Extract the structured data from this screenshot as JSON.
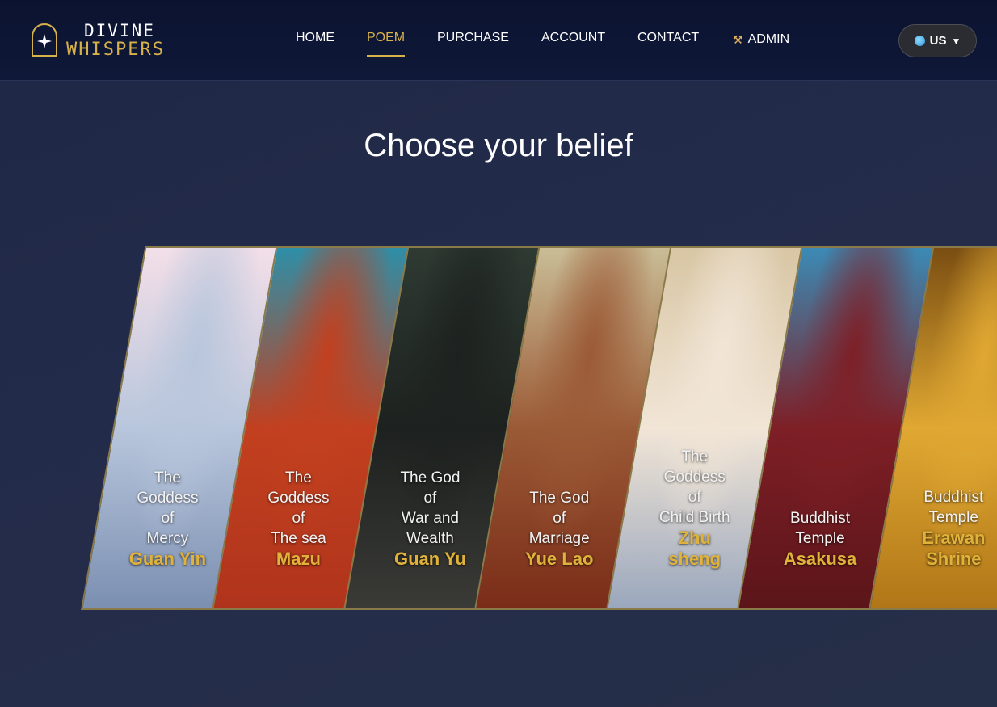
{
  "header": {
    "logo": {
      "line1": "DIVINE",
      "line2": "WHISPERS"
    },
    "nav": [
      {
        "label": "HOME",
        "active": false
      },
      {
        "label": "POEM",
        "active": true
      },
      {
        "label": "PURCHASE",
        "active": false
      },
      {
        "label": "ACCOUNT",
        "active": false
      },
      {
        "label": "CONTACT",
        "active": false
      },
      {
        "label": "ADMIN",
        "active": false,
        "icon": "hammer-wrench-icon"
      }
    ],
    "language": {
      "label": "US",
      "icon": "globe-icon"
    }
  },
  "main": {
    "title": "Choose your belief",
    "beliefs": [
      {
        "subtitle": "The\nGoddess\nof\nMercy",
        "name": "Guan Yin",
        "colors": [
          "#f3dfe8",
          "#b8c6dc",
          "#7b8fb1"
        ]
      },
      {
        "subtitle": "The\nGoddess\nof\nThe sea",
        "name": "Mazu",
        "colors": [
          "#2e8fa8",
          "#c2401f",
          "#b0341c"
        ]
      },
      {
        "subtitle": "The God\nof\nWar and\nWealth",
        "name": "Guan Yu",
        "colors": [
          "#2e3a32",
          "#1d211f",
          "#3a3a36"
        ]
      },
      {
        "subtitle": "The God\nof\nMarriage",
        "name": "Yue Lao",
        "colors": [
          "#c9bd96",
          "#9b5a36",
          "#7a2c18"
        ]
      },
      {
        "subtitle": "The\nGoddess\nof\nChild Birth",
        "name": "Zhu\nsheng",
        "colors": [
          "#d8c6a4",
          "#f1e5d6",
          "#9aa7bd"
        ]
      },
      {
        "subtitle": "Buddhist\nTemple",
        "name": "Asakusa",
        "colors": [
          "#3b8ab5",
          "#7e1f26",
          "#5b1519"
        ]
      },
      {
        "subtitle": "Buddhist\nTemple",
        "name": "Erawan\nShrine",
        "colors": [
          "#7a4e12",
          "#e0a832",
          "#b07618"
        ]
      }
    ]
  }
}
